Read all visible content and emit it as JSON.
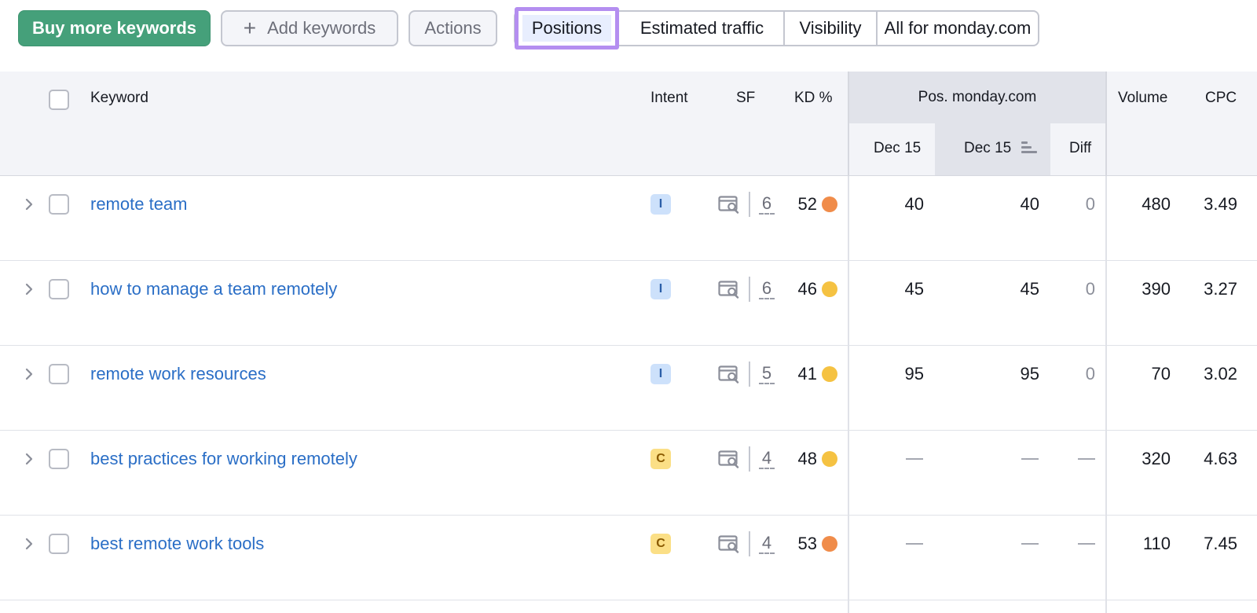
{
  "toolbar": {
    "buy_label": "Buy more keywords",
    "add_label": "Add keywords",
    "add_icon": "plus-icon",
    "actions_label": "Actions",
    "tabs": [
      {
        "label": "Positions",
        "selected": true
      },
      {
        "label": "Estimated traffic",
        "selected": false
      },
      {
        "label": "Visibility",
        "selected": false
      },
      {
        "label": "All for monday.com",
        "selected": false
      }
    ]
  },
  "table": {
    "headers": {
      "keyword": "Keyword",
      "intent": "Intent",
      "sf": "SF",
      "kd": "KD %",
      "pos_group": "Pos. monday.com",
      "pos_date_1": "Dec 15",
      "pos_date_2": "Dec 15",
      "diff": "Diff",
      "volume": "Volume",
      "cpc": "CPC"
    },
    "rows": [
      {
        "keyword": "remote team",
        "intent": "I",
        "sf": "6",
        "kd": "52",
        "kd_color": "#f08c4a",
        "pos1": "40",
        "pos2": "40",
        "diff": "0",
        "volume": "480",
        "cpc": "3.49"
      },
      {
        "keyword": "how to manage a team remotely",
        "intent": "I",
        "sf": "6",
        "kd": "46",
        "kd_color": "#f5c242",
        "pos1": "45",
        "pos2": "45",
        "diff": "0",
        "volume": "390",
        "cpc": "3.27"
      },
      {
        "keyword": "remote work resources",
        "intent": "I",
        "sf": "5",
        "kd": "41",
        "kd_color": "#f5c242",
        "pos1": "95",
        "pos2": "95",
        "diff": "0",
        "volume": "70",
        "cpc": "3.02"
      },
      {
        "keyword": "best practices for working remotely",
        "intent": "C",
        "sf": "4",
        "kd": "48",
        "kd_color": "#f5c242",
        "pos1": "",
        "pos2": "",
        "diff": "",
        "volume": "320",
        "cpc": "4.63"
      },
      {
        "keyword": "best remote work tools",
        "intent": "C",
        "sf": "4",
        "kd": "53",
        "kd_color": "#f08c4a",
        "pos1": "",
        "pos2": "",
        "diff": "",
        "volume": "110",
        "cpc": "7.45"
      }
    ]
  },
  "colors": {
    "brand_green": "#45a07a",
    "link_blue": "#2a6ec6",
    "highlight_purple": "#b48ef0"
  }
}
